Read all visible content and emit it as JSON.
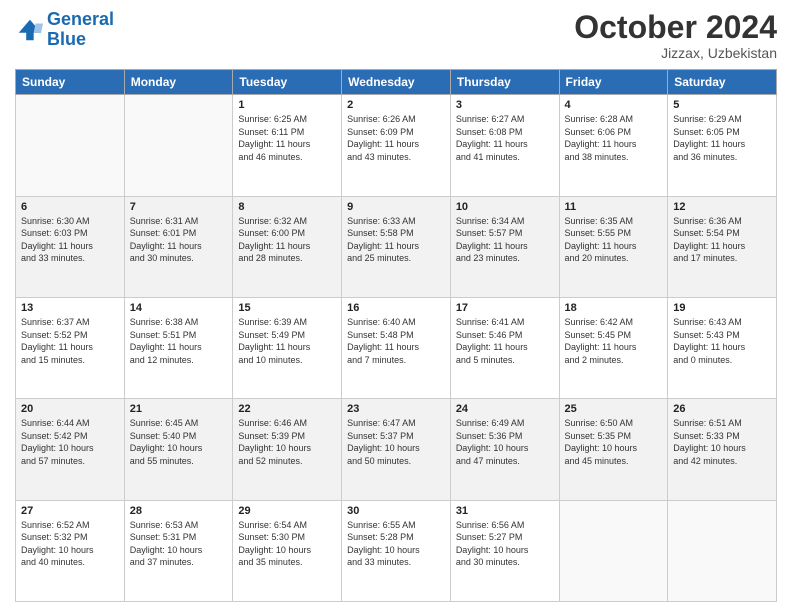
{
  "header": {
    "logo_line1": "General",
    "logo_line2": "Blue",
    "month_year": "October 2024",
    "location": "Jizzax, Uzbekistan"
  },
  "days_of_week": [
    "Sunday",
    "Monday",
    "Tuesday",
    "Wednesday",
    "Thursday",
    "Friday",
    "Saturday"
  ],
  "weeks": [
    {
      "shade": false,
      "days": [
        {
          "num": "",
          "info": ""
        },
        {
          "num": "",
          "info": ""
        },
        {
          "num": "1",
          "info": "Sunrise: 6:25 AM\nSunset: 6:11 PM\nDaylight: 11 hours\nand 46 minutes."
        },
        {
          "num": "2",
          "info": "Sunrise: 6:26 AM\nSunset: 6:09 PM\nDaylight: 11 hours\nand 43 minutes."
        },
        {
          "num": "3",
          "info": "Sunrise: 6:27 AM\nSunset: 6:08 PM\nDaylight: 11 hours\nand 41 minutes."
        },
        {
          "num": "4",
          "info": "Sunrise: 6:28 AM\nSunset: 6:06 PM\nDaylight: 11 hours\nand 38 minutes."
        },
        {
          "num": "5",
          "info": "Sunrise: 6:29 AM\nSunset: 6:05 PM\nDaylight: 11 hours\nand 36 minutes."
        }
      ]
    },
    {
      "shade": true,
      "days": [
        {
          "num": "6",
          "info": "Sunrise: 6:30 AM\nSunset: 6:03 PM\nDaylight: 11 hours\nand 33 minutes."
        },
        {
          "num": "7",
          "info": "Sunrise: 6:31 AM\nSunset: 6:01 PM\nDaylight: 11 hours\nand 30 minutes."
        },
        {
          "num": "8",
          "info": "Sunrise: 6:32 AM\nSunset: 6:00 PM\nDaylight: 11 hours\nand 28 minutes."
        },
        {
          "num": "9",
          "info": "Sunrise: 6:33 AM\nSunset: 5:58 PM\nDaylight: 11 hours\nand 25 minutes."
        },
        {
          "num": "10",
          "info": "Sunrise: 6:34 AM\nSunset: 5:57 PM\nDaylight: 11 hours\nand 23 minutes."
        },
        {
          "num": "11",
          "info": "Sunrise: 6:35 AM\nSunset: 5:55 PM\nDaylight: 11 hours\nand 20 minutes."
        },
        {
          "num": "12",
          "info": "Sunrise: 6:36 AM\nSunset: 5:54 PM\nDaylight: 11 hours\nand 17 minutes."
        }
      ]
    },
    {
      "shade": false,
      "days": [
        {
          "num": "13",
          "info": "Sunrise: 6:37 AM\nSunset: 5:52 PM\nDaylight: 11 hours\nand 15 minutes."
        },
        {
          "num": "14",
          "info": "Sunrise: 6:38 AM\nSunset: 5:51 PM\nDaylight: 11 hours\nand 12 minutes."
        },
        {
          "num": "15",
          "info": "Sunrise: 6:39 AM\nSunset: 5:49 PM\nDaylight: 11 hours\nand 10 minutes."
        },
        {
          "num": "16",
          "info": "Sunrise: 6:40 AM\nSunset: 5:48 PM\nDaylight: 11 hours\nand 7 minutes."
        },
        {
          "num": "17",
          "info": "Sunrise: 6:41 AM\nSunset: 5:46 PM\nDaylight: 11 hours\nand 5 minutes."
        },
        {
          "num": "18",
          "info": "Sunrise: 6:42 AM\nSunset: 5:45 PM\nDaylight: 11 hours\nand 2 minutes."
        },
        {
          "num": "19",
          "info": "Sunrise: 6:43 AM\nSunset: 5:43 PM\nDaylight: 11 hours\nand 0 minutes."
        }
      ]
    },
    {
      "shade": true,
      "days": [
        {
          "num": "20",
          "info": "Sunrise: 6:44 AM\nSunset: 5:42 PM\nDaylight: 10 hours\nand 57 minutes."
        },
        {
          "num": "21",
          "info": "Sunrise: 6:45 AM\nSunset: 5:40 PM\nDaylight: 10 hours\nand 55 minutes."
        },
        {
          "num": "22",
          "info": "Sunrise: 6:46 AM\nSunset: 5:39 PM\nDaylight: 10 hours\nand 52 minutes."
        },
        {
          "num": "23",
          "info": "Sunrise: 6:47 AM\nSunset: 5:37 PM\nDaylight: 10 hours\nand 50 minutes."
        },
        {
          "num": "24",
          "info": "Sunrise: 6:49 AM\nSunset: 5:36 PM\nDaylight: 10 hours\nand 47 minutes."
        },
        {
          "num": "25",
          "info": "Sunrise: 6:50 AM\nSunset: 5:35 PM\nDaylight: 10 hours\nand 45 minutes."
        },
        {
          "num": "26",
          "info": "Sunrise: 6:51 AM\nSunset: 5:33 PM\nDaylight: 10 hours\nand 42 minutes."
        }
      ]
    },
    {
      "shade": false,
      "days": [
        {
          "num": "27",
          "info": "Sunrise: 6:52 AM\nSunset: 5:32 PM\nDaylight: 10 hours\nand 40 minutes."
        },
        {
          "num": "28",
          "info": "Sunrise: 6:53 AM\nSunset: 5:31 PM\nDaylight: 10 hours\nand 37 minutes."
        },
        {
          "num": "29",
          "info": "Sunrise: 6:54 AM\nSunset: 5:30 PM\nDaylight: 10 hours\nand 35 minutes."
        },
        {
          "num": "30",
          "info": "Sunrise: 6:55 AM\nSunset: 5:28 PM\nDaylight: 10 hours\nand 33 minutes."
        },
        {
          "num": "31",
          "info": "Sunrise: 6:56 AM\nSunset: 5:27 PM\nDaylight: 10 hours\nand 30 minutes."
        },
        {
          "num": "",
          "info": ""
        },
        {
          "num": "",
          "info": ""
        }
      ]
    }
  ]
}
